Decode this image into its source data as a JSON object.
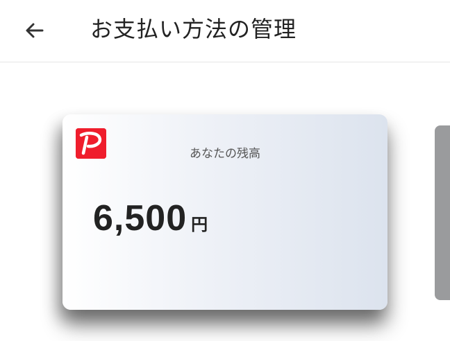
{
  "header": {
    "back_icon": "arrow-left-icon",
    "title": "お支払い方法の管理"
  },
  "card": {
    "logo_icon": "paypay-logo-icon",
    "caption": "あなたの残高",
    "amount": "6,500",
    "unit": "円"
  },
  "colors": {
    "brand": "#ef1d2c",
    "text": "#222222",
    "caption": "#555555",
    "next_card": "#9a9b9d"
  }
}
